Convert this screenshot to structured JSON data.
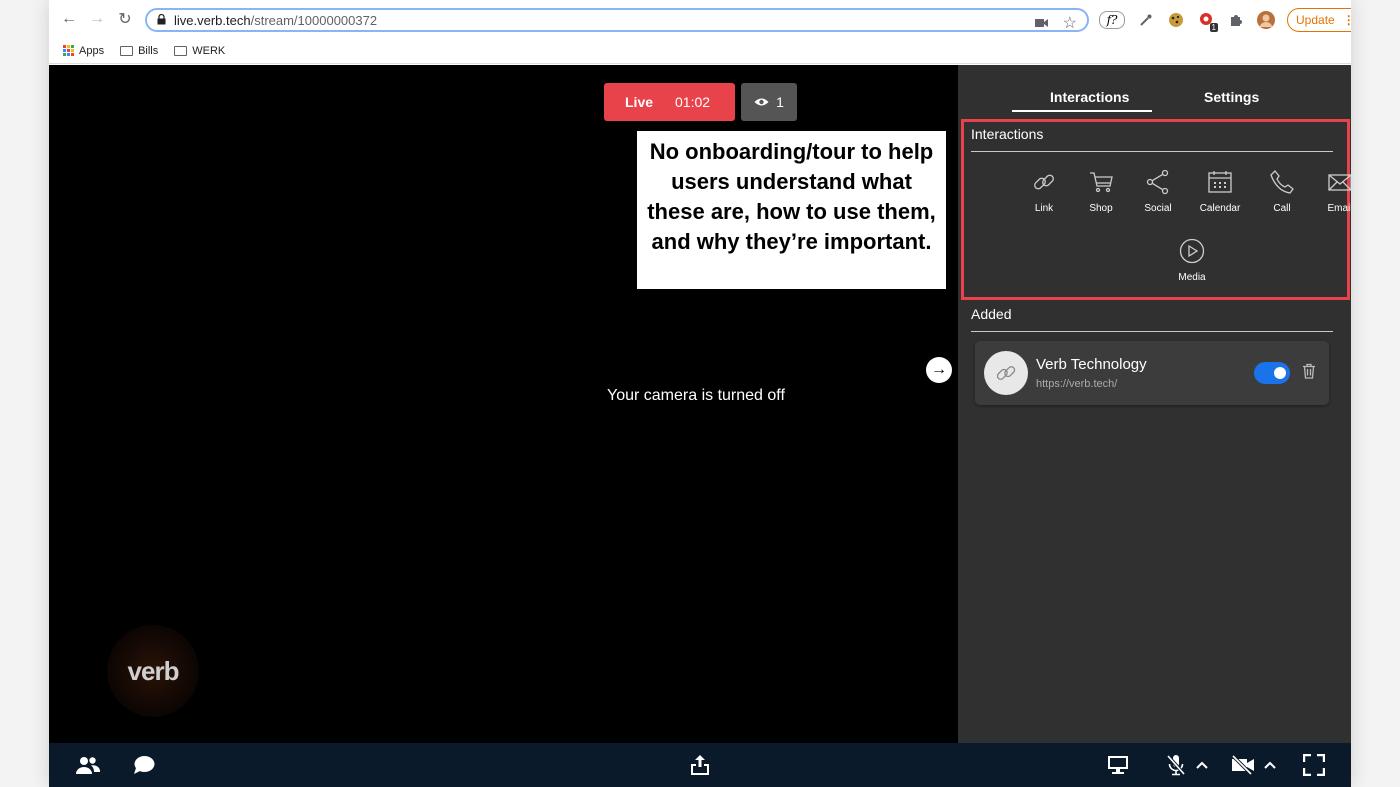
{
  "browser": {
    "url_host": "live.verb.tech",
    "url_path": "/stream/10000000372",
    "update_label": "Update",
    "extension_badge": "1"
  },
  "bookmarks": {
    "items": [
      "Apps",
      "Bills",
      "WERK"
    ]
  },
  "stream": {
    "live_label": "Live",
    "timer": "01:02",
    "viewer_count": "1",
    "camera_status": "Your camera is turned off",
    "logo_text": "verb"
  },
  "annotation": {
    "text": "No onboarding/tour to help users understand what these are, how to use them, and why they’re important."
  },
  "panel": {
    "tabs": [
      {
        "label": "Interactions",
        "active": true
      },
      {
        "label": "Settings",
        "active": false
      }
    ],
    "interactions_title": "Interactions",
    "interaction_items": [
      {
        "label": "Link",
        "icon": "link-icon"
      },
      {
        "label": "Shop",
        "icon": "cart-icon"
      },
      {
        "label": "Social",
        "icon": "share-icon"
      },
      {
        "label": "Calendar",
        "icon": "calendar-icon"
      },
      {
        "label": "Call",
        "icon": "phone-icon"
      },
      {
        "label": "Email",
        "icon": "mail-icon"
      },
      {
        "label": "Media",
        "icon": "play-icon"
      }
    ],
    "added_title": "Added",
    "added_items": [
      {
        "title": "Verb Technology",
        "url": "https://verb.tech/",
        "enabled": true
      }
    ]
  },
  "colors": {
    "live_red": "#e8424a",
    "panel_bg": "#303030",
    "toggle_blue": "#1a73e8",
    "bottom_bar": "#0b1a2b"
  }
}
